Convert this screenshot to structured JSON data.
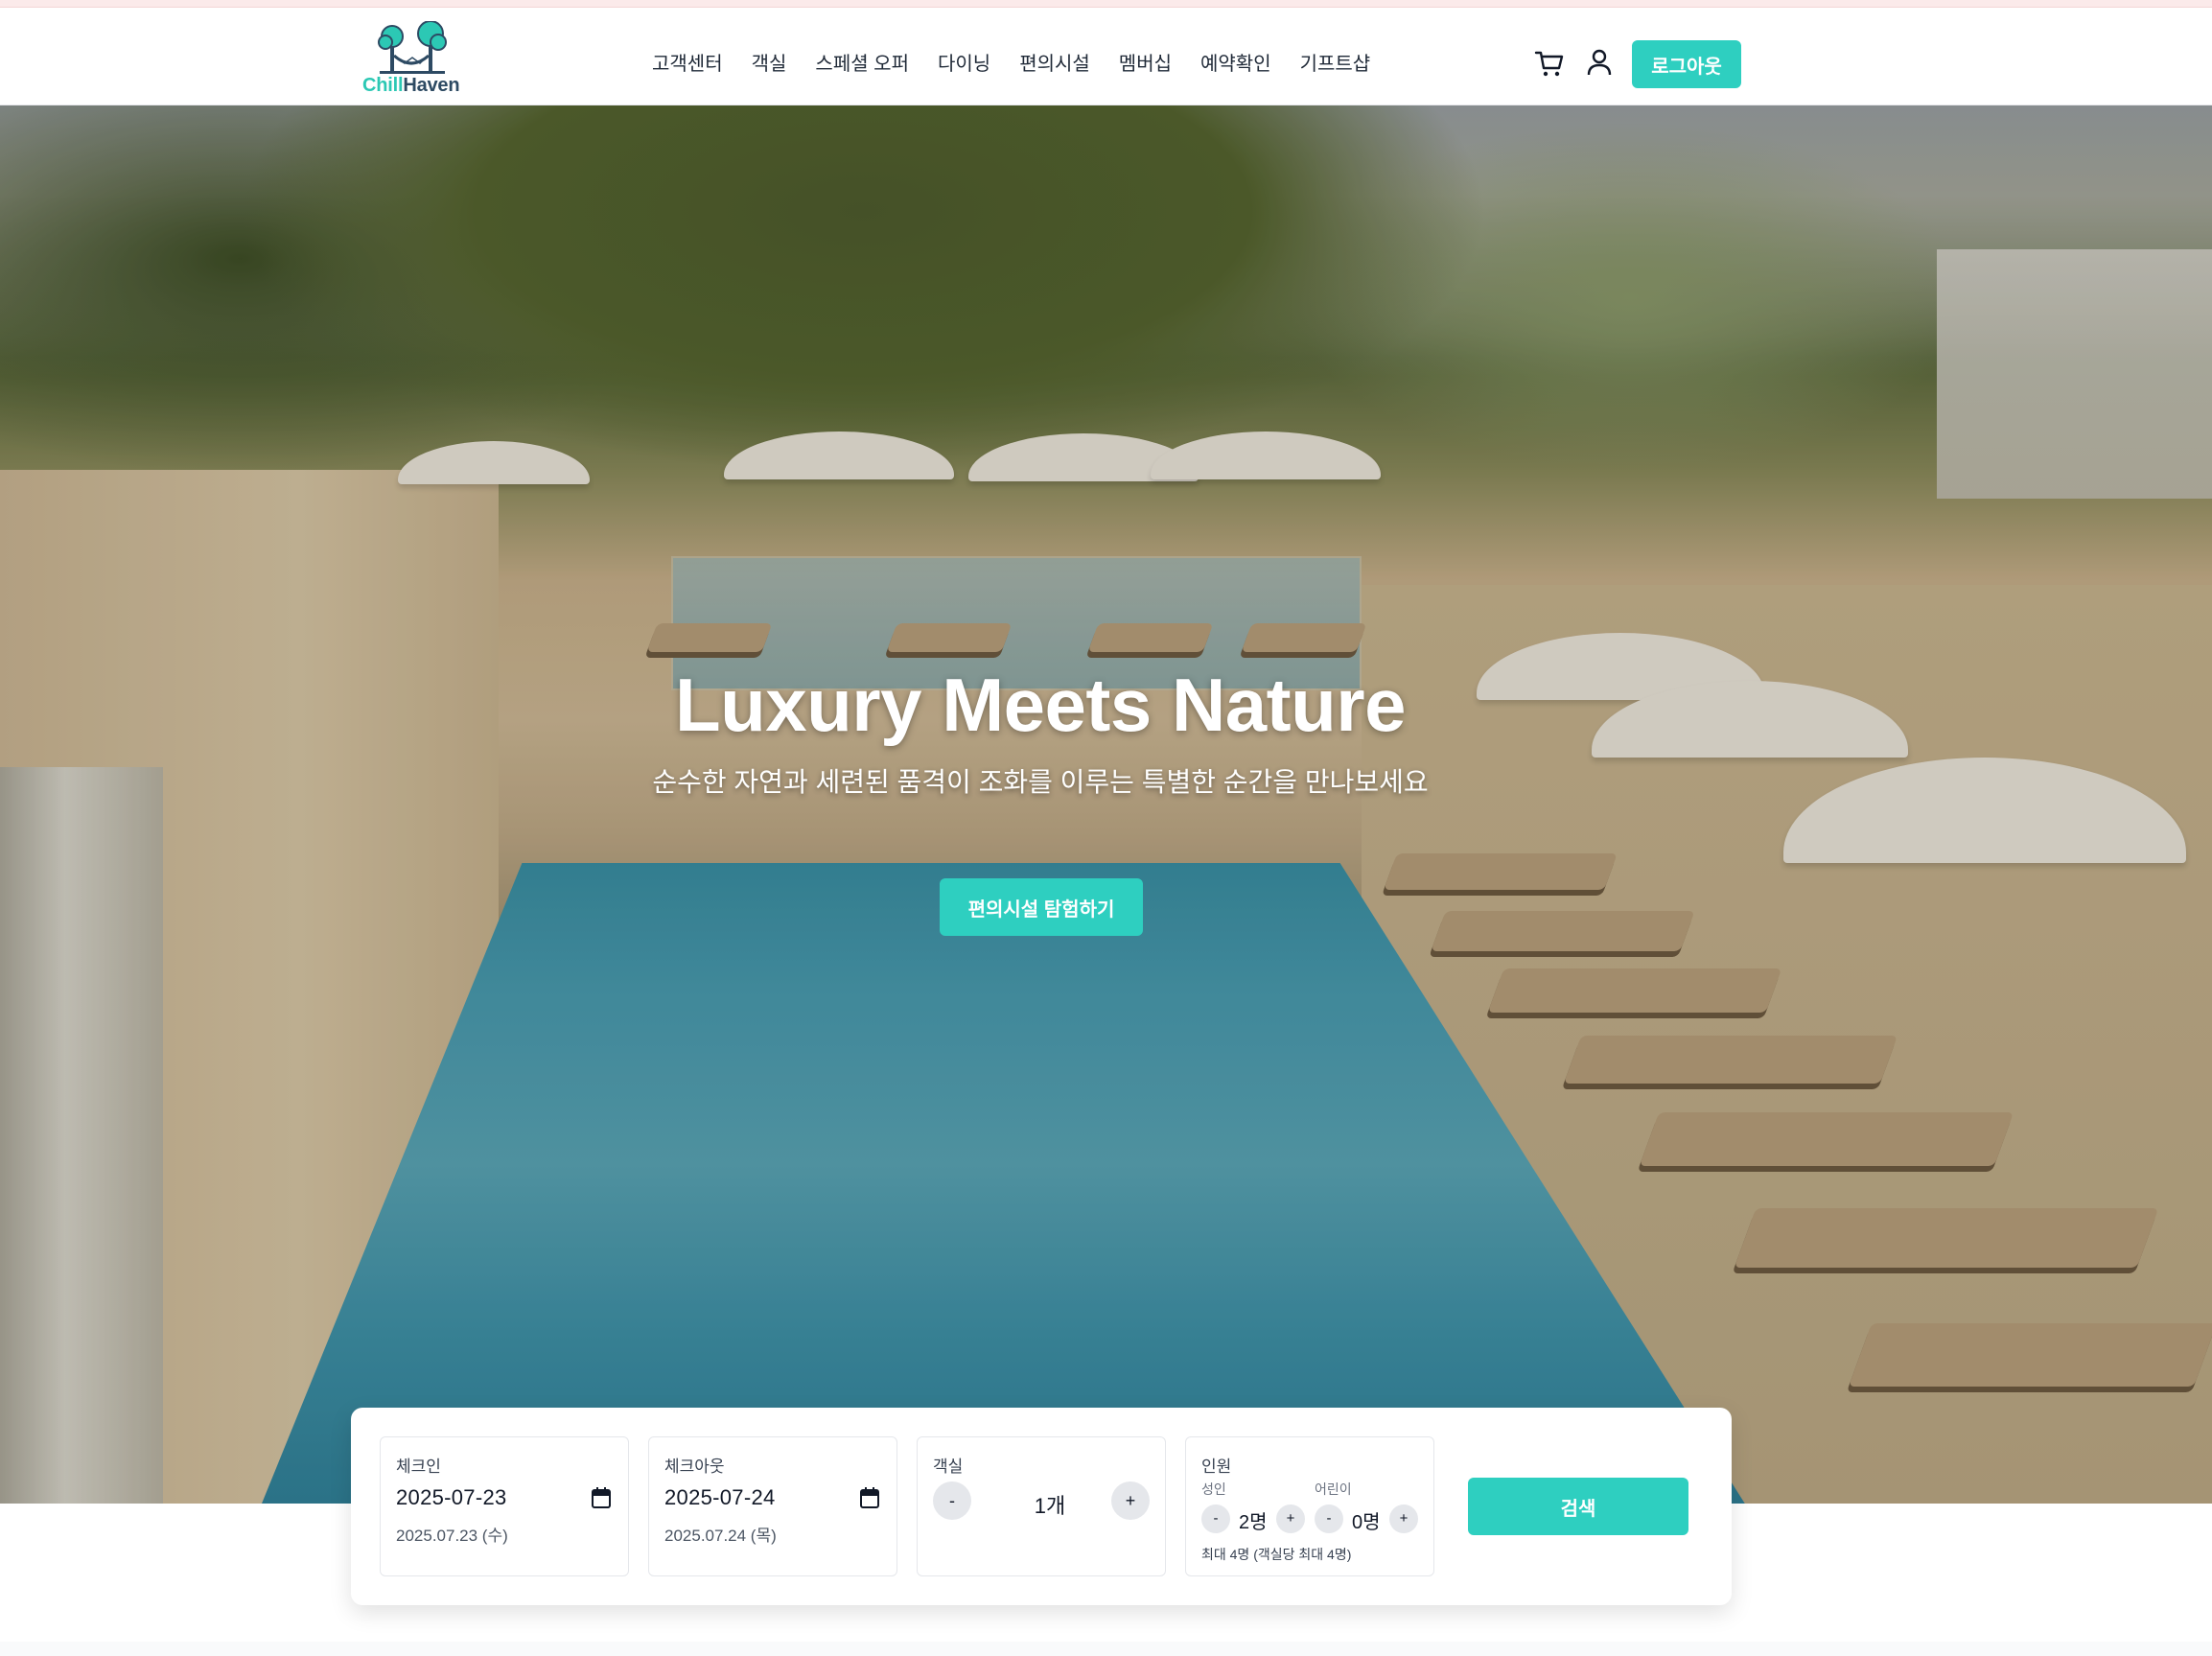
{
  "brand": {
    "logo_part1": "Chill",
    "logo_part2": "Haven",
    "accent_color": "#2ecfc0"
  },
  "nav": {
    "items": [
      "고객센터",
      "객실",
      "스페셜 오퍼",
      "다이닝",
      "편의시설",
      "멤버십",
      "예약확인",
      "기프트샵"
    ]
  },
  "header_actions": {
    "cart_icon": "cart-icon",
    "user_icon": "user-icon",
    "logout_label": "로그아웃"
  },
  "hero": {
    "title": "Luxury Meets Nature",
    "subtitle": "순수한 자연과 세련된 품격이 조화를 이루는 특별한 순간을 만나보세요",
    "cta_label": "편의시설 탐험하기"
  },
  "booking": {
    "checkin": {
      "label": "체크인",
      "value": "2025-07-23",
      "display": "2025.07.23 (수)"
    },
    "checkout": {
      "label": "체크아웃",
      "value": "2025-07-24",
      "display": "2025.07.24 (목)"
    },
    "rooms": {
      "label": "객실",
      "value": "1개",
      "minus": "-",
      "plus": "+"
    },
    "guests": {
      "label": "인원",
      "adults_label": "성인",
      "adults_value": "2명",
      "children_label": "어린이",
      "children_value": "0명",
      "minus": "-",
      "plus": "+",
      "note": "최대 4명 (객실당 최대 4명)"
    },
    "search_label": "검색"
  }
}
